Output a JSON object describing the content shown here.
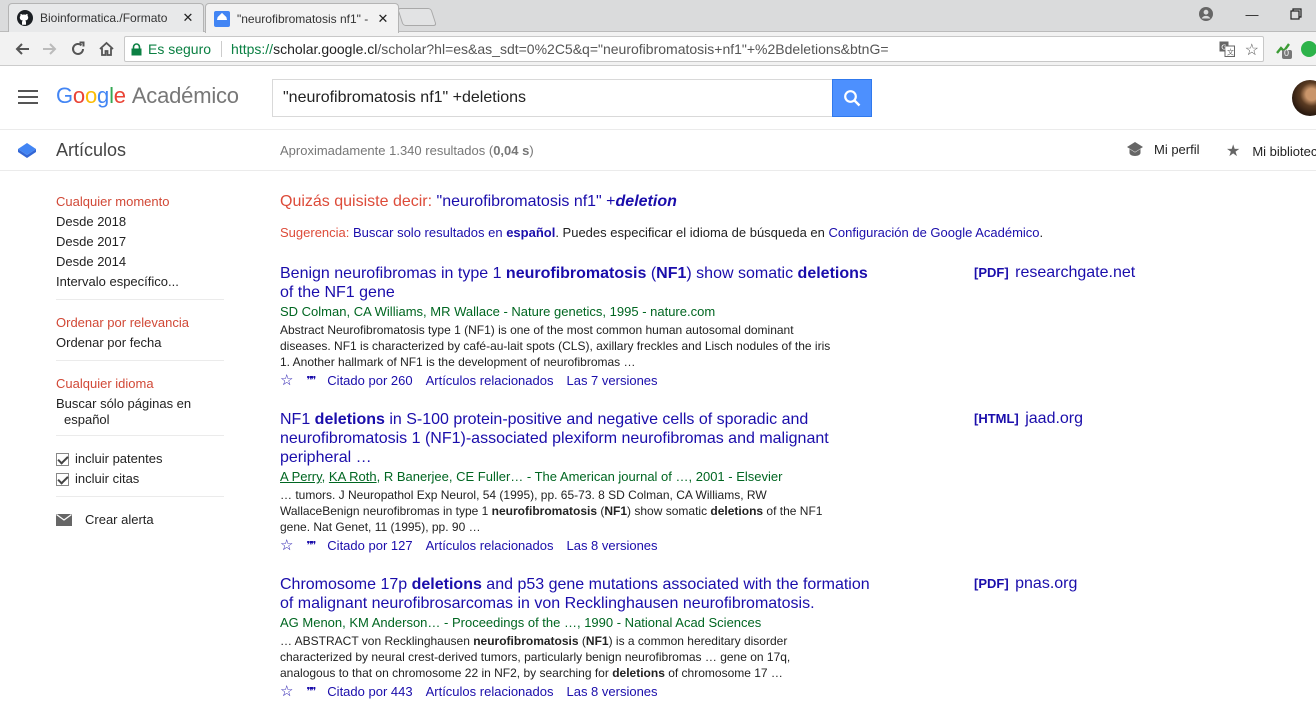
{
  "browser": {
    "tabs": [
      {
        "title": "Bioinformatica./Formato",
        "favicon": "github-icon"
      },
      {
        "title": "\"neurofibromatosis nf1\" -",
        "favicon": "google-scholar-icon"
      }
    ],
    "security_label": "Es seguro",
    "url": {
      "scheme": "https://",
      "host": "scholar.google.cl",
      "path": "/scholar?hl=es&as_sdt=0%2C5&q=\"neurofibromatosis+nf1\"+%2Bdeletions&btnG="
    },
    "extension_badge": "0"
  },
  "header": {
    "logo_google": [
      "G",
      "o",
      "o",
      "g",
      "l",
      "e"
    ],
    "logo_colors": [
      "#4285f4",
      "#ea4335",
      "#fbbc05",
      "#4285f4",
      "#34a853",
      "#ea4335"
    ],
    "logo_suffix": "Académico",
    "search_value": "\"neurofibromatosis nf1\" +deletions"
  },
  "subheader": {
    "section": "Artículos",
    "count_prefix": "Aproximadamente 1.340 resultados (",
    "count_time": "0,04 s",
    "count_suffix": ")",
    "profile": "Mi perfil",
    "library": "Mi bibliotec"
  },
  "sidebar": {
    "time": [
      "Cualquier momento",
      "Desde 2018",
      "Desde 2017",
      "Desde 2014",
      "Intervalo específico..."
    ],
    "sort": [
      "Ordenar por relevancia",
      "Ordenar por fecha"
    ],
    "lang": [
      "Cualquier idioma",
      "Buscar sólo páginas en",
      "español"
    ],
    "checks": [
      "incluir patentes",
      "incluir citas"
    ],
    "alert": "Crear alerta"
  },
  "main": {
    "didyou_prefix": "Quizás quisiste decir: ",
    "didyou_link": "\"neurofibromatosis nf1\" +",
    "didyou_bold": "deletion",
    "sugg_label": "Sugerencia: ",
    "sugg_link1": "Buscar solo resultados en ",
    "sugg_link1_bold": "español",
    "sugg_mid": ". Puedes especificar el idioma de búsqueda en ",
    "sugg_link2": "Configuración de Google Académico",
    "sugg_end": "."
  },
  "results": [
    {
      "title": [
        {
          "t": "Benign neurofibromas in type 1 ",
          "b": false
        },
        {
          "t": "neurofibromatosis",
          "b": true
        },
        {
          "t": " (",
          "b": false
        },
        {
          "t": "NF1",
          "b": true
        },
        {
          "t": ") show somatic ",
          "b": false
        },
        {
          "t": "deletions",
          "b": true
        },
        {
          "t": " of the NF1 gene",
          "b": false
        }
      ],
      "authors": "SD Colman, CA Williams, MR Wallace - Nature genetics, 1995 - nature.com",
      "snippet": [
        {
          "t": "Abstract Neurofibromatosis type 1 (NF1) is one of the most common human autosomal dominant diseases. NF1 is characterized by café-au-lait spots (CLS), axillary freckles and Lisch nodules of the iris 1. Another hallmark of NF1 is the development of neurofibromas …",
          "b": false
        }
      ],
      "cited": "Citado por 260",
      "related": "Artículos relacionados",
      "versions": "Las 7 versiones",
      "side_tag": "[PDF]",
      "side_site": "researchgate.net"
    },
    {
      "title": [
        {
          "t": "NF1 ",
          "b": false
        },
        {
          "t": "deletions",
          "b": true
        },
        {
          "t": " in S-100 protein-positive and negative cells of sporadic and neurofibromatosis 1 (NF1)-associated plexiform neurofibromas and malignant peripheral …",
          "b": false
        }
      ],
      "authors_u": [
        "A Perry",
        "KA Roth"
      ],
      "authors": "R Banerjee, CE Fuller… - The American journal of …, 2001 - Elsevier",
      "snippet": [
        {
          "t": "… tumors. J Neuropathol Exp Neurol, 54 (1995), pp. 65-73. 8 SD Colman, CA Williams, RW WallaceBenign neurofibromas in type 1 ",
          "b": false
        },
        {
          "t": "neurofibromatosis",
          "b": true
        },
        {
          "t": " (",
          "b": false
        },
        {
          "t": "NF1",
          "b": true
        },
        {
          "t": ") show somatic ",
          "b": false
        },
        {
          "t": "deletions",
          "b": true
        },
        {
          "t": " of the NF1 gene. Nat Genet, 11 (1995), pp. 90 …",
          "b": false
        }
      ],
      "cited": "Citado por 127",
      "related": "Artículos relacionados",
      "versions": "Las 8 versiones",
      "side_tag": "[HTML]",
      "side_site": "jaad.org"
    },
    {
      "title": [
        {
          "t": "Chromosome 17p ",
          "b": false
        },
        {
          "t": "deletions",
          "b": true
        },
        {
          "t": " and p53 gene mutations associated with the formation of malignant neurofibrosarcomas in von Recklinghausen neurofibromatosis.",
          "b": false
        }
      ],
      "authors": "AG Menon, KM Anderson… - Proceedings of the …, 1990 - National Acad Sciences",
      "snippet": [
        {
          "t": "… ABSTRACT von Recklinghausen ",
          "b": false
        },
        {
          "t": "neurofibromatosis",
          "b": true
        },
        {
          "t": " (",
          "b": false
        },
        {
          "t": "NF1",
          "b": true
        },
        {
          "t": ") is a common hereditary disorder characterized by neural crest-derived tumors, particularly benign neurofibromas … gene on 17q, analogous to that on chromosome 22 in NF2, by searching for ",
          "b": false
        },
        {
          "t": "deletions",
          "b": true
        },
        {
          "t": " of chromosome 17 …",
          "b": false
        }
      ],
      "cited": "Citado por 443",
      "related": "Artículos relacionados",
      "versions": "Las 8 versiones",
      "side_tag": "[PDF]",
      "side_site": "pnas.org"
    }
  ]
}
